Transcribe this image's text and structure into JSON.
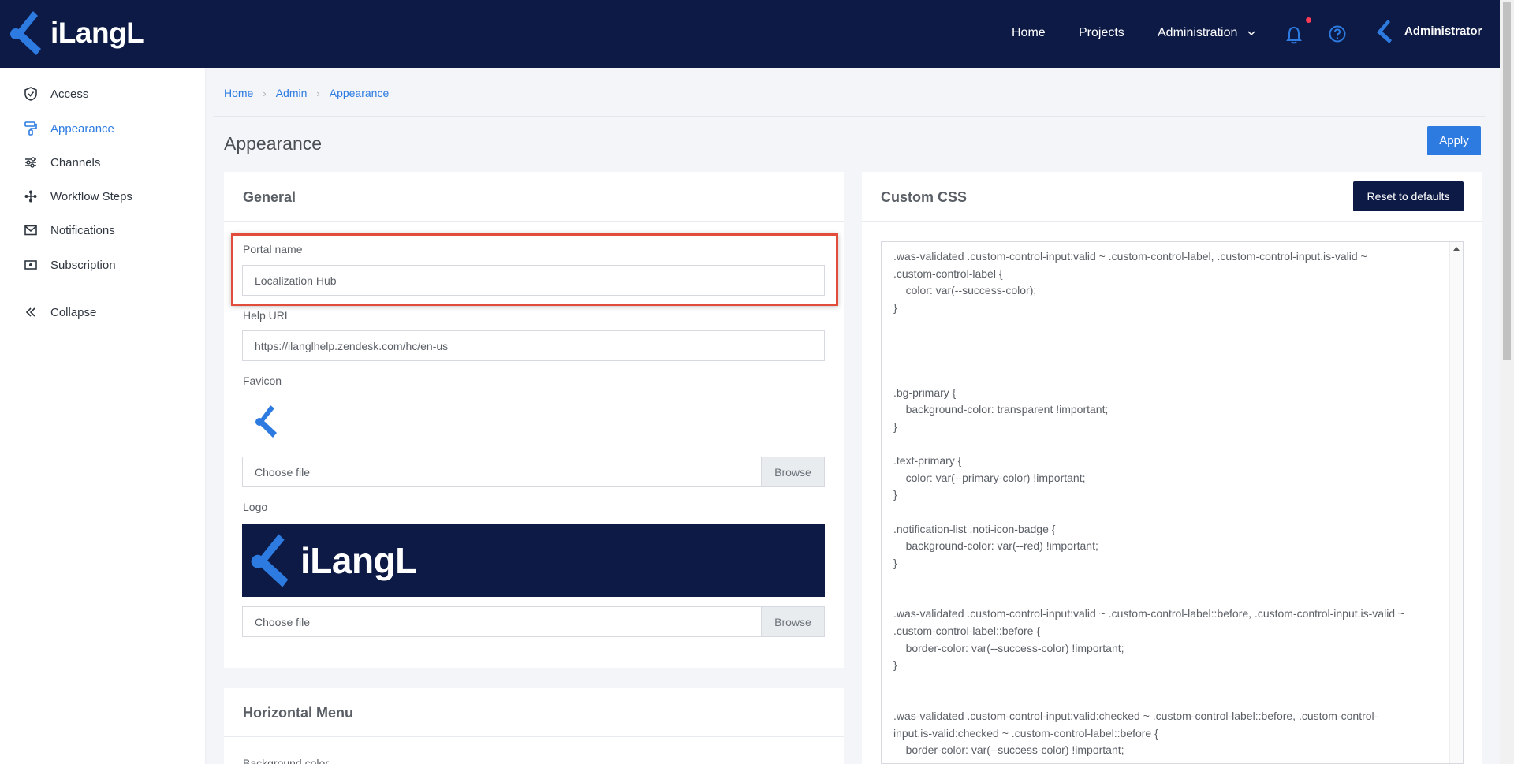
{
  "app": {
    "logo_text": "iLangL"
  },
  "topnav": {
    "home": "Home",
    "projects": "Projects",
    "administration": "Administration",
    "user_name": "Administrator"
  },
  "sidebar": {
    "items": [
      {
        "label": "Access",
        "icon": "shield-check-icon"
      },
      {
        "label": "Appearance",
        "icon": "paint-roller-icon"
      },
      {
        "label": "Channels",
        "icon": "sliders-icon"
      },
      {
        "label": "Workflow Steps",
        "icon": "workflow-icon"
      },
      {
        "label": "Notifications",
        "icon": "mail-icon"
      },
      {
        "label": "Subscription",
        "icon": "ticket-icon"
      }
    ],
    "collapse": "Collapse"
  },
  "breadcrumb": [
    "Home",
    "Admin",
    "Appearance"
  ],
  "page": {
    "title": "Appearance",
    "apply": "Apply"
  },
  "general": {
    "title": "General",
    "portal_name_label": "Portal name",
    "portal_name_value": "Localization Hub",
    "help_url_label": "Help URL",
    "help_url_value": "https://ilanglhelp.zendesk.com/hc/en-us",
    "favicon_label": "Favicon",
    "favicon_file": "Choose file",
    "favicon_browse": "Browse",
    "logo_label": "Logo",
    "logo_preview_text": "iLangL",
    "logo_file": "Choose file",
    "logo_browse": "Browse"
  },
  "horizontal_menu": {
    "title": "Horizontal Menu",
    "bg_label": "Background color"
  },
  "custom_css": {
    "title": "Custom CSS",
    "reset": "Reset to defaults",
    "content": ".was-validated .custom-control-input:valid ~ .custom-control-label, .custom-control-input.is-valid ~\n.custom-control-label {\n    color: var(--success-color);\n}\n\n\n\n\n.bg-primary {\n    background-color: transparent !important;\n}\n\n.text-primary {\n    color: var(--primary-color) !important;\n}\n\n.notification-list .noti-icon-badge {\n    background-color: var(--red) !important;\n}\n\n\n.was-validated .custom-control-input:valid ~ .custom-control-label::before, .custom-control-input.is-valid ~\n.custom-control-label::before {\n    border-color: var(--success-color) !important;\n}\n\n\n.was-validated .custom-control-input:valid:checked ~ .custom-control-label::before, .custom-control-\ninput.is-valid:checked ~ .custom-control-label::before {\n    border-color: var(--success-color) !important;\n    background-color: var(--success-color) !important;\n}"
  },
  "colors": {
    "navy": "#0c1a45",
    "accent": "#2d7be0",
    "highlight": "#e24c3a"
  }
}
